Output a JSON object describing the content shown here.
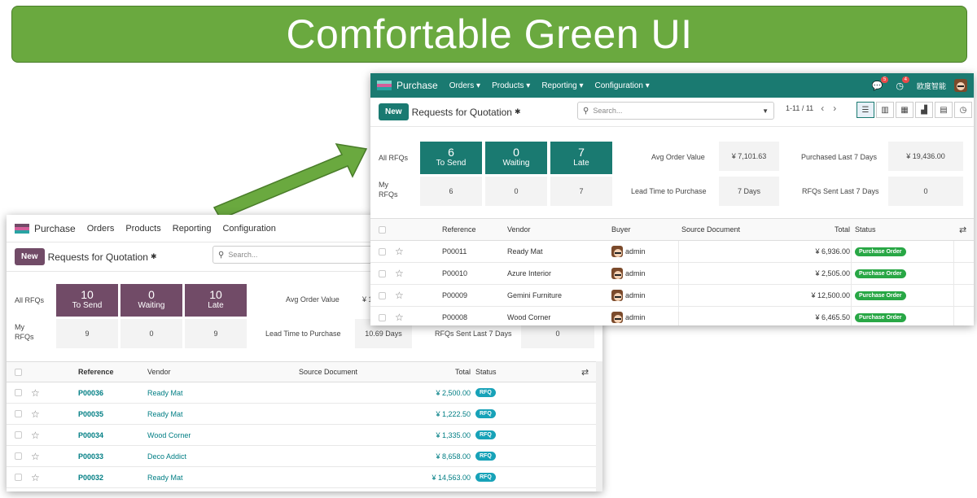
{
  "banner": {
    "title": "Comfortable Green UI"
  },
  "back_window": {
    "nav": {
      "app": "Purchase",
      "menus": [
        "Orders",
        "Products",
        "Reporting",
        "Configuration"
      ]
    },
    "control": {
      "new_label": "New",
      "title": "Requests for Quotation",
      "search_placeholder": "Search..."
    },
    "stats": {
      "all_rfqs": "All RFQs",
      "my_rfqs": "My\nRFQs",
      "tiles": [
        {
          "n": "10",
          "l": "To Send"
        },
        {
          "n": "0",
          "l": "Waiting"
        },
        {
          "n": "10",
          "l": "Late"
        }
      ],
      "my": [
        "9",
        "0",
        "9"
      ],
      "avg_label": "Avg Order Value",
      "avg_value": "¥ 1",
      "lead_label": "Lead Time to Purchase",
      "lead_value": "10.69 Days",
      "sent_label": "RFQs Sent Last 7 Days",
      "sent_value": "0"
    },
    "table": {
      "headers": {
        "reference": "Reference",
        "vendor": "Vendor",
        "source": "Source Document",
        "total": "Total",
        "status": "Status"
      },
      "rows": [
        {
          "ref": "P00036",
          "vendor": "Ready Mat",
          "total": "¥ 2,500.00",
          "status": "RFQ"
        },
        {
          "ref": "P00035",
          "vendor": "Ready Mat",
          "total": "¥ 1,222.50",
          "status": "RFQ"
        },
        {
          "ref": "P00034",
          "vendor": "Wood Corner",
          "total": "¥ 1,335.00",
          "status": "RFQ"
        },
        {
          "ref": "P00033",
          "vendor": "Deco Addict",
          "total": "¥ 8,658.00",
          "status": "RFQ"
        },
        {
          "ref": "P00032",
          "vendor": "Ready Mat",
          "total": "¥ 14,563.00",
          "status": "RFQ"
        }
      ]
    }
  },
  "front_window": {
    "nav": {
      "app": "Purchase",
      "menus": [
        "Orders ▾",
        "Products ▾",
        "Reporting ▾",
        "Configuration ▾"
      ],
      "msg_count": "5",
      "act_count": "4",
      "company": "欧度智能"
    },
    "control": {
      "new_label": "New",
      "title": "Requests for Quotation",
      "search_placeholder": "Search...",
      "pager": "1-11 / 11"
    },
    "stats": {
      "all_rfqs": "All RFQs",
      "my_rfqs": "My\nRFQs",
      "tiles": [
        {
          "n": "6",
          "l": "To Send"
        },
        {
          "n": "0",
          "l": "Waiting"
        },
        {
          "n": "7",
          "l": "Late"
        }
      ],
      "my": [
        "6",
        "0",
        "7"
      ],
      "avg_label": "Avg Order Value",
      "avg_value": "¥ 7,101.63",
      "purchased_label": "Purchased Last 7 Days",
      "purchased_value": "¥ 19,436.00",
      "lead_label": "Lead Time to Purchase",
      "lead_value": "7 Days",
      "sent_label": "RFQs Sent Last 7 Days",
      "sent_value": "0"
    },
    "table": {
      "headers": {
        "reference": "Reference",
        "vendor": "Vendor",
        "buyer": "Buyer",
        "source": "Source Document",
        "total": "Total",
        "status": "Status"
      },
      "rows": [
        {
          "ref": "P00011",
          "vendor": "Ready Mat",
          "buyer": "admin",
          "total": "¥ 6,936.00",
          "status": "Purchase Order"
        },
        {
          "ref": "P00010",
          "vendor": "Azure Interior",
          "buyer": "admin",
          "total": "¥ 2,505.00",
          "status": "Purchase Order"
        },
        {
          "ref": "P00009",
          "vendor": "Gemini Furniture",
          "buyer": "admin",
          "total": "¥ 12,500.00",
          "status": "Purchase Order"
        },
        {
          "ref": "P00008",
          "vendor": "Wood Corner",
          "buyer": "admin",
          "total": "¥ 6,465.50",
          "status": "Purchase Order"
        }
      ]
    }
  },
  "colors": {
    "banner": "#6aa93f",
    "purple": "#714b67",
    "teal": "#1a7a71",
    "rfq_badge": "#17a2b8",
    "po_badge": "#28a745"
  }
}
